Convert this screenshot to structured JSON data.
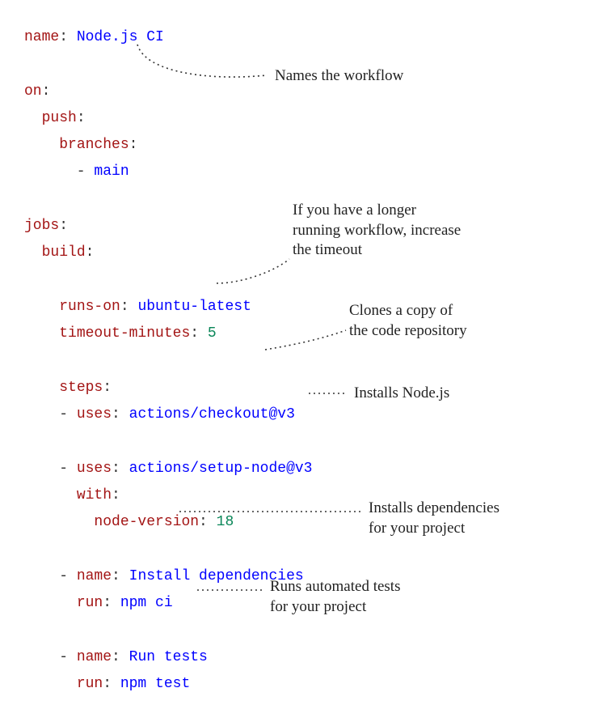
{
  "code": {
    "name_key": "name",
    "name_val": "Node.js CI",
    "on_key": "on",
    "push_key": "push",
    "branches_key": "branches",
    "branch_val": "main",
    "jobs_key": "jobs",
    "build_key": "build",
    "runs_on_key": "runs-on",
    "runs_on_val": "ubuntu-latest",
    "timeout_key": "timeout-minutes",
    "timeout_val": "5",
    "steps_key": "steps",
    "uses_key": "uses",
    "checkout_val": "actions/checkout@v3",
    "setup_node_val": "actions/setup-node@v3",
    "with_key": "with",
    "node_version_key": "node-version",
    "node_version_val": "18",
    "step_name_key": "name",
    "install_name": "Install dependencies",
    "run_key": "run",
    "install_cmd": "npm ci",
    "tests_name": "Run tests",
    "tests_cmd": "npm test"
  },
  "annotations": {
    "names": "Names the workflow",
    "timeout": "If you have a longer\nrunning workflow, increase\nthe timeout",
    "clones": "Clones a copy of\nthe code repository",
    "installs_node": "Installs Node.js",
    "installs_deps": "Installs dependencies\nfor your project",
    "runs_tests": "Runs automated tests\nfor your project"
  }
}
